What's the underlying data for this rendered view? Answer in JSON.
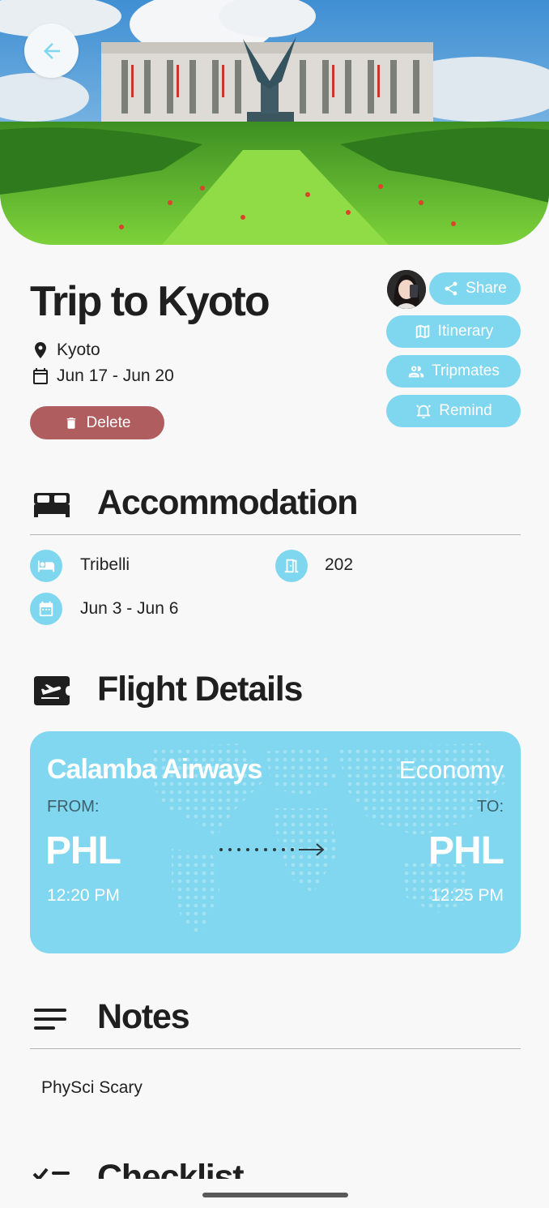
{
  "trip": {
    "title": "Trip to Kyoto",
    "location": "Kyoto",
    "dates": "Jun 17 - Jun 20",
    "delete_label": "Delete"
  },
  "actions": {
    "share": "Share",
    "itinerary": "Itinerary",
    "tripmates": "Tripmates",
    "remind": "Remind"
  },
  "accommodation": {
    "title": "Accommodation",
    "hotel": "Tribelli",
    "room": "202",
    "dates": "Jun 3 - Jun 6"
  },
  "flight": {
    "title": "Flight Details",
    "airline": "Calamba Airways",
    "class": "Economy",
    "from_label": "FROM:",
    "to_label": "TO:",
    "from_code": "PHL",
    "to_code": "PHL",
    "depart_time": "12:20 PM",
    "arrive_time": "12:25 PM"
  },
  "notes": {
    "title": "Notes",
    "text": "PhySci Scary"
  },
  "checklist": {
    "title": "Checklist"
  },
  "colors": {
    "accent": "#7fd7ef",
    "delete": "#b05d60",
    "background": "#f8f8f8"
  },
  "icons": [
    "arrow-left-icon",
    "location-pin-icon",
    "calendar-icon",
    "trash-icon",
    "share-icon",
    "map-icon",
    "people-icon",
    "alarm-icon",
    "bed-icon",
    "hotel-icon",
    "door-icon",
    "event-icon",
    "flight-ticket-icon",
    "notes-icon",
    "checklist-icon"
  ]
}
